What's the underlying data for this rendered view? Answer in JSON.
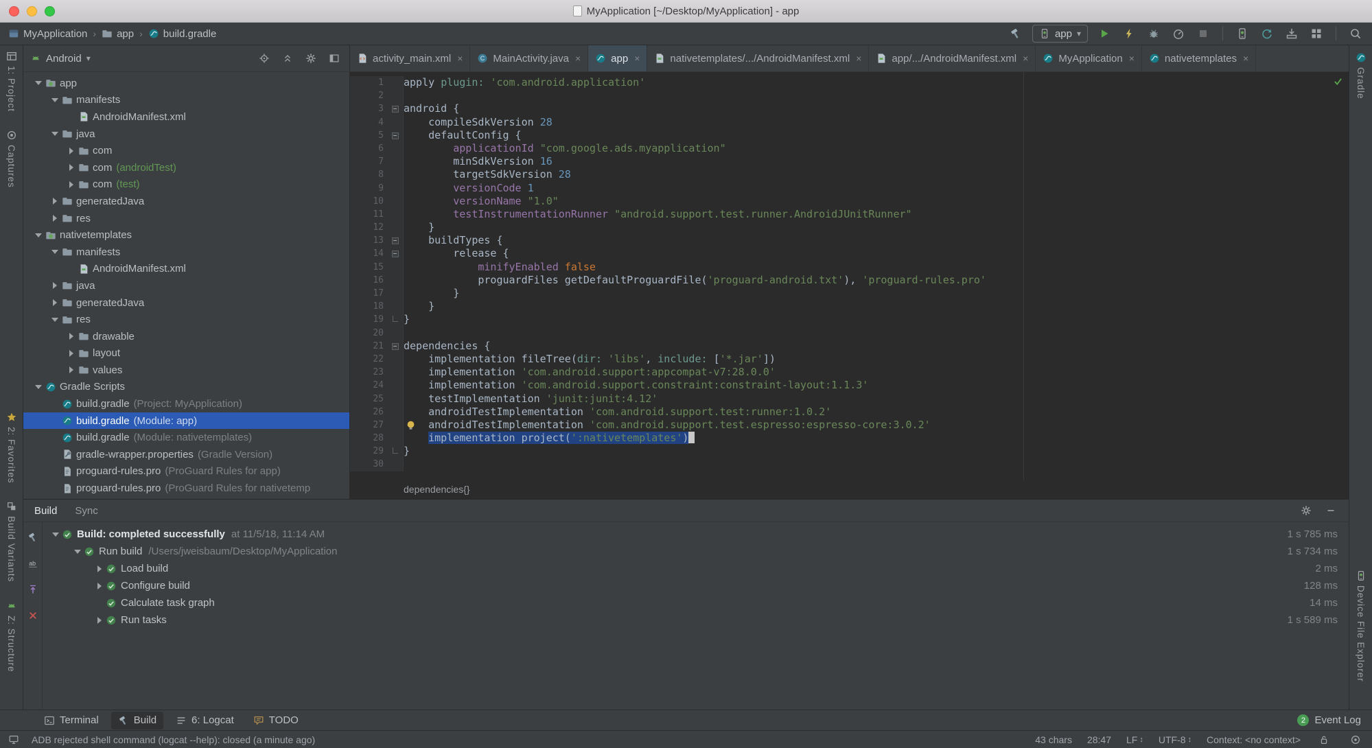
{
  "window": {
    "title": "MyApplication [~/Desktop/MyApplication] - app"
  },
  "toolbar": {
    "breadcrumbs": [
      {
        "icon": "project",
        "label": "MyApplication"
      },
      {
        "icon": "folder",
        "label": "app"
      },
      {
        "icon": "gradle",
        "label": "build.gradle"
      }
    ],
    "run_config": {
      "label": "app"
    },
    "actions_before": [
      "build-hammer"
    ],
    "actions_after": [
      "run",
      "apply-changes",
      "debug",
      "profile",
      "stop",
      "divider",
      "avd-manager",
      "sync-project",
      "sdk-manager",
      "layout-inspector",
      "divider",
      "search-everywhere"
    ]
  },
  "left_strip": {
    "top": [
      {
        "icon": "project-tool",
        "label": "1: Project"
      },
      {
        "icon": "captures-tool",
        "label": "Captures"
      }
    ],
    "bottom": [
      {
        "icon": "star",
        "label": "2: Favorites"
      },
      {
        "icon": "variants-tool",
        "label": "Build Variants"
      },
      {
        "icon": "android-head",
        "label": "Z: Structure"
      }
    ]
  },
  "right_strip": {
    "top": [
      {
        "icon": "gradle",
        "label": "Gradle"
      }
    ],
    "bottom": [
      {
        "icon": "device",
        "label": "Device File Explorer"
      }
    ]
  },
  "project_panel": {
    "selector": {
      "label": "Android"
    },
    "header_icons": [
      "locate",
      "collapse-all",
      "settings",
      "hide"
    ],
    "tree": [
      {
        "indent": 0,
        "arrow": "down",
        "icon": "module",
        "label": "app"
      },
      {
        "indent": 1,
        "arrow": "down",
        "icon": "folder",
        "label": "manifests"
      },
      {
        "indent": 2,
        "arrow": null,
        "icon": "androidfile",
        "label": "AndroidManifest.xml"
      },
      {
        "indent": 1,
        "arrow": "down",
        "icon": "folder",
        "label": "java"
      },
      {
        "indent": 2,
        "arrow": "right",
        "icon": "folder",
        "label": "com"
      },
      {
        "indent": 2,
        "arrow": "right",
        "icon": "folder",
        "label": "com",
        "annotation": "(androidTest)",
        "annColor": "green"
      },
      {
        "indent": 2,
        "arrow": "right",
        "icon": "folder",
        "label": "com",
        "annotation": "(test)",
        "annColor": "green"
      },
      {
        "indent": 1,
        "arrow": "right",
        "icon": "folder",
        "label": "generatedJava"
      },
      {
        "indent": 1,
        "arrow": "right",
        "icon": "folder",
        "label": "res"
      },
      {
        "indent": 0,
        "arrow": "down",
        "icon": "module",
        "label": "nativetemplates"
      },
      {
        "indent": 1,
        "arrow": "down",
        "icon": "folder",
        "label": "manifests"
      },
      {
        "indent": 2,
        "arrow": null,
        "icon": "androidfile",
        "label": "AndroidManifest.xml"
      },
      {
        "indent": 1,
        "arrow": "right",
        "icon": "folder",
        "label": "java"
      },
      {
        "indent": 1,
        "arrow": "right",
        "icon": "folder",
        "label": "generatedJava"
      },
      {
        "indent": 1,
        "arrow": "down",
        "icon": "folder",
        "label": "res"
      },
      {
        "indent": 2,
        "arrow": "right",
        "icon": "folder",
        "label": "drawable"
      },
      {
        "indent": 2,
        "arrow": "right",
        "icon": "folder",
        "label": "layout"
      },
      {
        "indent": 2,
        "arrow": "right",
        "icon": "folder",
        "label": "values"
      },
      {
        "indent": 0,
        "arrow": "down",
        "icon": "gradle",
        "label": "Gradle Scripts"
      },
      {
        "indent": 1,
        "arrow": null,
        "icon": "gradle",
        "label": "build.gradle",
        "annotation": "(Project: MyApplication)"
      },
      {
        "indent": 1,
        "arrow": null,
        "icon": "gradle",
        "label": "build.gradle",
        "annotation": "(Module: app)",
        "selected": true
      },
      {
        "indent": 1,
        "arrow": null,
        "icon": "gradle",
        "label": "build.gradle",
        "annotation": "(Module: nativetemplates)"
      },
      {
        "indent": 1,
        "arrow": null,
        "icon": "wrenchfile",
        "label": "gradle-wrapper.properties",
        "annotation": "(Gradle Version)"
      },
      {
        "indent": 1,
        "arrow": null,
        "icon": "file",
        "label": "proguard-rules.pro",
        "annotation": "(ProGuard Rules for app)"
      },
      {
        "indent": 1,
        "arrow": null,
        "icon": "file",
        "label": "proguard-rules.pro",
        "annotation": "(ProGuard Rules for nativetemp"
      }
    ]
  },
  "editor": {
    "tabs": [
      {
        "icon": "xmlfile",
        "label": "activity_main.xml",
        "active": false
      },
      {
        "icon": "classfile",
        "label": "MainActivity.java",
        "active": false
      },
      {
        "icon": "gradle",
        "label": "app",
        "active": true
      },
      {
        "icon": "androidfile",
        "label": "nativetemplates/.../AndroidManifest.xml",
        "active": false
      },
      {
        "icon": "androidfile",
        "label": "app/.../AndroidManifest.xml",
        "active": false
      },
      {
        "icon": "gradle",
        "label": "MyApplication",
        "active": false
      },
      {
        "icon": "gradle",
        "label": "nativetemplates",
        "active": false
      }
    ],
    "breadcrumb": "dependencies{}",
    "lines": [
      {
        "n": 1,
        "t": [
          [
            "p",
            "apply "
          ],
          [
            "a",
            "plugin: "
          ],
          [
            "s",
            "'com.android.application'"
          ]
        ]
      },
      {
        "n": 2,
        "t": []
      },
      {
        "n": 3,
        "fold": "open",
        "t": [
          [
            "p",
            "android {"
          ]
        ]
      },
      {
        "n": 4,
        "t": [
          [
            "p",
            "    compileSdkVersion "
          ],
          [
            "n",
            "28"
          ]
        ]
      },
      {
        "n": 5,
        "fold": "open",
        "t": [
          [
            "p",
            "    defaultConfig {"
          ]
        ]
      },
      {
        "n": 6,
        "t": [
          [
            "p",
            "        "
          ],
          [
            "f",
            "applicationId "
          ],
          [
            "s",
            "\"com.google.ads.myapplication\""
          ]
        ]
      },
      {
        "n": 7,
        "t": [
          [
            "p",
            "        minSdkVersion "
          ],
          [
            "n",
            "16"
          ]
        ]
      },
      {
        "n": 8,
        "t": [
          [
            "p",
            "        targetSdkVersion "
          ],
          [
            "n",
            "28"
          ]
        ]
      },
      {
        "n": 9,
        "t": [
          [
            "p",
            "        "
          ],
          [
            "f",
            "versionCode "
          ],
          [
            "n",
            "1"
          ]
        ]
      },
      {
        "n": 10,
        "t": [
          [
            "p",
            "        "
          ],
          [
            "f",
            "versionName "
          ],
          [
            "s",
            "\"1.0\""
          ]
        ]
      },
      {
        "n": 11,
        "t": [
          [
            "p",
            "        "
          ],
          [
            "f",
            "testInstrumentationRunner "
          ],
          [
            "s",
            "\"android.support.test.runner.AndroidJUnitRunner\""
          ]
        ]
      },
      {
        "n": 12,
        "t": [
          [
            "p",
            "    }"
          ]
        ]
      },
      {
        "n": 13,
        "fold": "open",
        "t": [
          [
            "p",
            "    buildTypes {"
          ]
        ]
      },
      {
        "n": 14,
        "fold": "open",
        "t": [
          [
            "p",
            "        release {"
          ]
        ]
      },
      {
        "n": 15,
        "t": [
          [
            "p",
            "            "
          ],
          [
            "f",
            "minifyEnabled "
          ],
          [
            "k",
            "false"
          ]
        ]
      },
      {
        "n": 16,
        "t": [
          [
            "p",
            "            proguardFiles getDefaultProguardFile("
          ],
          [
            "s",
            "'proguard-android.txt'"
          ],
          [
            "p",
            "), "
          ],
          [
            "s",
            "'proguard-rules.pro'"
          ]
        ]
      },
      {
        "n": 17,
        "t": [
          [
            "p",
            "        }"
          ]
        ]
      },
      {
        "n": 18,
        "t": [
          [
            "p",
            "    }"
          ]
        ]
      },
      {
        "n": 19,
        "fold": "close",
        "t": [
          [
            "p",
            "}"
          ]
        ]
      },
      {
        "n": 20,
        "t": []
      },
      {
        "n": 21,
        "fold": "open",
        "t": [
          [
            "p",
            "dependencies {"
          ]
        ]
      },
      {
        "n": 22,
        "t": [
          [
            "p",
            "    implementation fileTree("
          ],
          [
            "a",
            "dir: "
          ],
          [
            "s",
            "'libs'"
          ],
          [
            "p",
            ", "
          ],
          [
            "a",
            "include: "
          ],
          [
            "p",
            "["
          ],
          [
            "s",
            "'*.jar'"
          ],
          [
            "p",
            "])"
          ]
        ]
      },
      {
        "n": 23,
        "t": [
          [
            "p",
            "    implementation "
          ],
          [
            "s",
            "'com.android.support:appcompat-v7:28.0.0'"
          ]
        ]
      },
      {
        "n": 24,
        "t": [
          [
            "p",
            "    implementation "
          ],
          [
            "s",
            "'com.android.support.constraint:constraint-layout:1.1.3'"
          ]
        ]
      },
      {
        "n": 25,
        "t": [
          [
            "p",
            "    testImplementation "
          ],
          [
            "s",
            "'junit:junit:4.12'"
          ]
        ]
      },
      {
        "n": 26,
        "t": [
          [
            "p",
            "    androidTestImplementation "
          ],
          [
            "s",
            "'com.android.support.test:runner:1.0.2'"
          ]
        ]
      },
      {
        "n": 27,
        "bulb": true,
        "t": [
          [
            "p",
            "    androidTestImplementation "
          ],
          [
            "s",
            "'com.android.support.test.espresso:espresso-core:3.0.2'"
          ]
        ]
      },
      {
        "n": 28,
        "cursor": true,
        "t": [
          [
            "p",
            "    "
          ],
          [
            "ps",
            "implementation project("
          ],
          [
            "ss",
            "':nativetemplates'"
          ],
          [
            "ps",
            ")"
          ]
        ]
      },
      {
        "n": 29,
        "fold": "close",
        "t": [
          [
            "p",
            "}"
          ]
        ]
      },
      {
        "n": 30,
        "t": []
      }
    ]
  },
  "build_panel": {
    "tabs": [
      {
        "label": "Build",
        "active": true
      },
      {
        "label": "Sync",
        "active": false
      }
    ],
    "toolbar_icons": [
      "rerun-build",
      "filter",
      "export",
      "close"
    ],
    "header_icons": [
      "settings",
      "minimize"
    ],
    "rows": [
      {
        "indent": 0,
        "arrow": "down",
        "label": "Build: completed successfully",
        "detail": "at 11/5/18, 11:14 AM",
        "time": "1 s 785 ms",
        "bold": true
      },
      {
        "indent": 1,
        "arrow": "down",
        "label": "Run build",
        "detail": "/Users/jweisbaum/Desktop/MyApplication",
        "time": "1 s 734 ms"
      },
      {
        "indent": 2,
        "arrow": "right",
        "label": "Load build",
        "time": "2 ms"
      },
      {
        "indent": 2,
        "arrow": "right",
        "label": "Configure build",
        "time": "128 ms"
      },
      {
        "indent": 2,
        "arrow": null,
        "label": "Calculate task graph",
        "time": "14 ms"
      },
      {
        "indent": 2,
        "arrow": "right",
        "label": "Run tasks",
        "time": "1 s 589 ms"
      }
    ]
  },
  "bottom_bar": {
    "items": [
      {
        "icon": "terminal",
        "label": "Terminal",
        "active": false
      },
      {
        "icon": "build-tool",
        "label": "Build",
        "active": true
      },
      {
        "icon": "loglist",
        "label": "6: Logcat",
        "active": false
      },
      {
        "icon": "todo",
        "label": "TODO",
        "active": false
      }
    ],
    "event_log": {
      "badge": "2",
      "label": "Event Log"
    }
  },
  "status_bar": {
    "message": "ADB rejected shell command (logcat --help): closed (a minute ago)",
    "items": [
      {
        "label": "43 chars"
      },
      {
        "label": "28:47"
      },
      {
        "label": "LF",
        "arrow": true
      },
      {
        "label": "UTF-8",
        "arrow": true
      },
      {
        "label": "Context: <no context>"
      }
    ],
    "icons": [
      "lock",
      "inspections"
    ]
  }
}
